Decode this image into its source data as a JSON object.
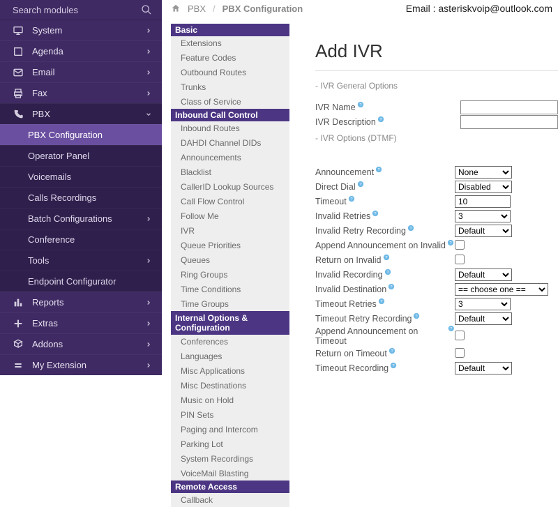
{
  "search": {
    "placeholder": "Search modules"
  },
  "nav": [
    {
      "icon": "monitor",
      "label": "System",
      "expand": true
    },
    {
      "icon": "book",
      "label": "Agenda",
      "expand": true
    },
    {
      "icon": "mail",
      "label": "Email",
      "expand": true
    },
    {
      "icon": "printer",
      "label": "Fax",
      "expand": true
    },
    {
      "icon": "phone",
      "label": "PBX",
      "expand": true,
      "open": true
    },
    {
      "icon": "bars",
      "label": "Reports",
      "expand": true
    },
    {
      "icon": "plus",
      "label": "Extras",
      "expand": true
    },
    {
      "icon": "cubes",
      "label": "Addons",
      "expand": true
    },
    {
      "icon": "equal",
      "label": "My Extension",
      "expand": true
    }
  ],
  "pbx_sub": [
    {
      "label": "PBX Configuration",
      "active": true
    },
    {
      "label": "Operator Panel"
    },
    {
      "label": "Voicemails"
    },
    {
      "label": "Calls Recordings"
    },
    {
      "label": "Batch Configurations",
      "expand": true
    },
    {
      "label": "Conference"
    },
    {
      "label": "Tools",
      "expand": true
    },
    {
      "label": "Endpoint Configurator"
    }
  ],
  "breadcrumb": {
    "root": "PBX",
    "current": "PBX Configuration"
  },
  "email_note": "Email : asteriskvoip@outlook.com",
  "col2": {
    "groups": [
      {
        "title": "Basic",
        "items": [
          "Extensions",
          "Feature Codes",
          "Outbound Routes",
          "Trunks",
          "Class of Service"
        ]
      },
      {
        "title": "Inbound Call Control",
        "items": [
          "Inbound Routes",
          "DAHDI Channel DIDs",
          "Announcements",
          "Blacklist",
          "CallerID Lookup Sources",
          "Call Flow Control",
          "Follow Me",
          "IVR",
          "Queue Priorities",
          "Queues",
          "Ring Groups",
          "Time Conditions",
          "Time Groups"
        ]
      },
      {
        "title": "Internal Options & Configuration",
        "wrap": true,
        "items": [
          "Conferences",
          "Languages",
          "Misc Applications",
          "Misc Destinations",
          "Music on Hold",
          "PIN Sets",
          "Paging and Intercom",
          "Parking Lot",
          "System Recordings",
          "VoiceMail Blasting"
        ]
      },
      {
        "title": "Remote Access",
        "items": [
          "Callback"
        ]
      }
    ]
  },
  "form": {
    "title": "Add IVR",
    "section1": "- IVR General Options",
    "ivr_name": "IVR Name",
    "ivr_desc": "IVR Description",
    "section2": "- IVR Options (DTMF)",
    "fields": {
      "announcement": "Announcement",
      "direct_dial": "Direct Dial",
      "timeout": "Timeout",
      "invalid_retries": "Invalid Retries",
      "invalid_retry_rec": "Invalid Retry Recording",
      "append_inv": "Append Announcement on Invalid",
      "return_inv": "Return on Invalid",
      "invalid_rec": "Invalid Recording",
      "invalid_dest": "Invalid Destination",
      "timeout_retries": "Timeout Retries",
      "timeout_retry_rec": "Timeout Retry Recording",
      "append_to": "Append Announcement on Timeout",
      "return_to": "Return on Timeout",
      "timeout_rec": "Timeout Recording"
    },
    "values": {
      "announcement": "None",
      "direct_dial": "Disabled",
      "timeout": "10",
      "invalid_retries": "3",
      "invalid_retry_rec": "Default",
      "invalid_rec": "Default",
      "invalid_dest": "== choose one ==",
      "timeout_retries": "3",
      "timeout_retry_rec": "Default",
      "timeout_rec": "Default"
    }
  }
}
